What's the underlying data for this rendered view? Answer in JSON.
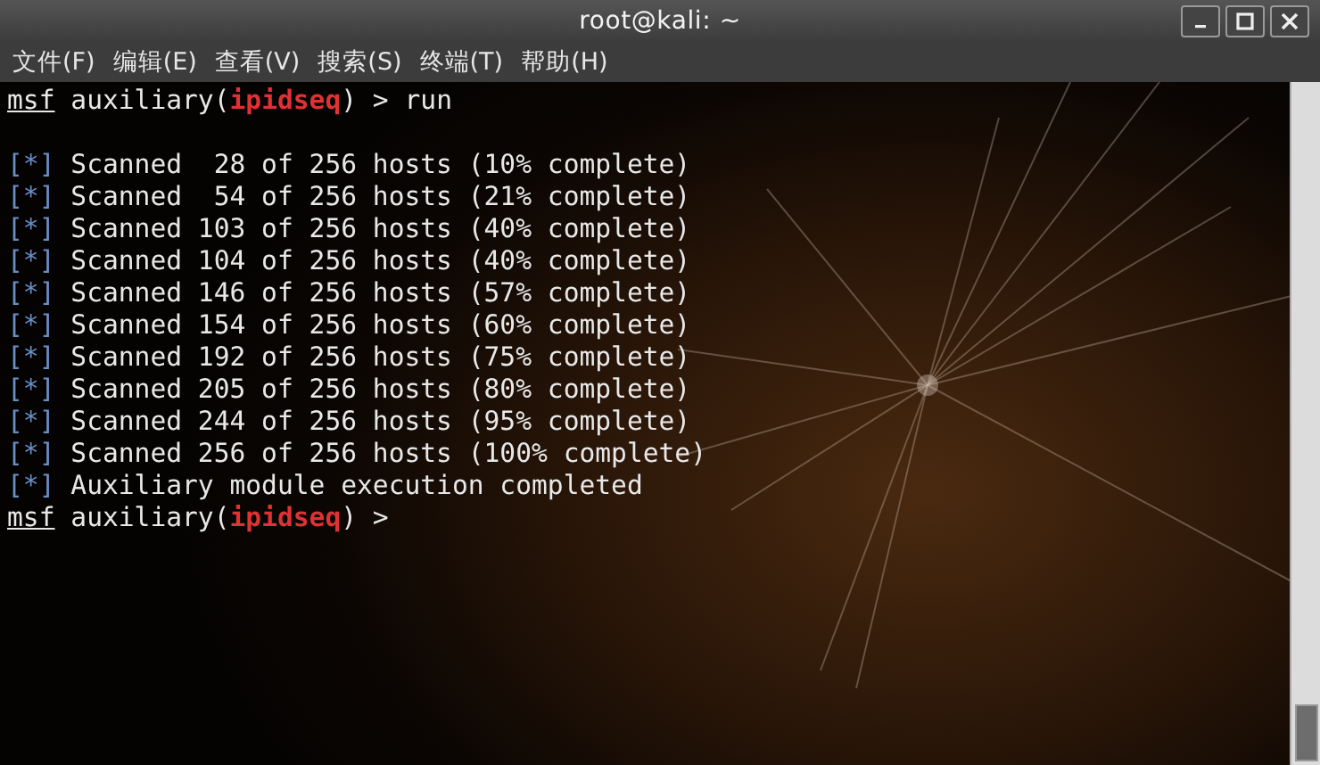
{
  "window": {
    "title": "root@kali: ~"
  },
  "menu": [
    {
      "label": "文件(F)"
    },
    {
      "label": "编辑(E)"
    },
    {
      "label": "查看(V)"
    },
    {
      "label": "搜索(S)"
    },
    {
      "label": "终端(T)"
    },
    {
      "label": "帮助(H)"
    }
  ],
  "terminal": {
    "lines": [
      {
        "kind": "prompt",
        "prompt": "msf",
        "context": "auxiliary(**ipidseq**) >",
        "command": "run"
      },
      {
        "kind": "blank"
      },
      {
        "kind": "status",
        "marker": "[*]",
        "text": "Scanned  28 of 256 hosts (10% complete)"
      },
      {
        "kind": "status",
        "marker": "[*]",
        "text": "Scanned  54 of 256 hosts (21% complete)"
      },
      {
        "kind": "status",
        "marker": "[*]",
        "text": "Scanned 103 of 256 hosts (40% complete)"
      },
      {
        "kind": "status",
        "marker": "[*]",
        "text": "Scanned 104 of 256 hosts (40% complete)"
      },
      {
        "kind": "status",
        "marker": "[*]",
        "text": "Scanned 146 of 256 hosts (57% complete)"
      },
      {
        "kind": "status",
        "marker": "[*]",
        "text": "Scanned 154 of 256 hosts (60% complete)"
      },
      {
        "kind": "status",
        "marker": "[*]",
        "text": "Scanned 192 of 256 hosts (75% complete)"
      },
      {
        "kind": "status",
        "marker": "[*]",
        "text": "Scanned 205 of 256 hosts (80% complete)"
      },
      {
        "kind": "status",
        "marker": "[*]",
        "text": "Scanned 244 of 256 hosts (95% complete)"
      },
      {
        "kind": "status",
        "marker": "[*]",
        "text": "Scanned 256 of 256 hosts (100% complete)"
      },
      {
        "kind": "status",
        "marker": "[*]",
        "text": "Auxiliary module execution completed"
      },
      {
        "kind": "prompt",
        "prompt": "msf",
        "context": "auxiliary(**ipidseq**) >"
      }
    ]
  }
}
